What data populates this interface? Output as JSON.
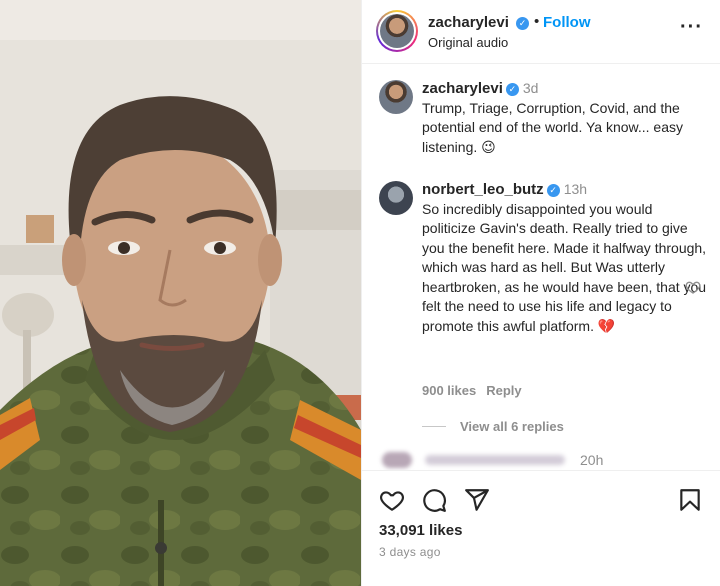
{
  "header": {
    "username": "zacharylevi",
    "dot": "•",
    "follow_label": "Follow",
    "audio": "Original audio",
    "more": "···"
  },
  "caption": {
    "username": "zacharylevi",
    "time": "3d",
    "text": "Trump, Triage, Corruption, Covid, and the potential end of the world. Ya know... easy listening. 😉"
  },
  "comment": {
    "username": "norbert_leo_butz",
    "time": "13h",
    "text": "So incredibly disappointed you would politicize Gavin's death. Really tried to give you the benefit here. Made it halfway through, which was hard as hell. But Was utterly heartbroken, as he would have been, that you felt the need to use his life and legacy to promote this awful platform. 💔",
    "likes": "900 likes",
    "reply_label": "Reply",
    "view_replies": "View all 6 replies"
  },
  "next_comment": {
    "time": "20h"
  },
  "footer": {
    "likes": "33,091 likes",
    "ago": "3 days ago"
  },
  "icons": {
    "like": "heart-icon",
    "comment": "comment-bubble-icon",
    "share": "paper-plane-icon",
    "save": "bookmark-icon",
    "verified": "verified-badge-icon"
  },
  "colors": {
    "accent": "#0095f6",
    "verified": "#3897f0",
    "muted": "#8e8e8e"
  }
}
